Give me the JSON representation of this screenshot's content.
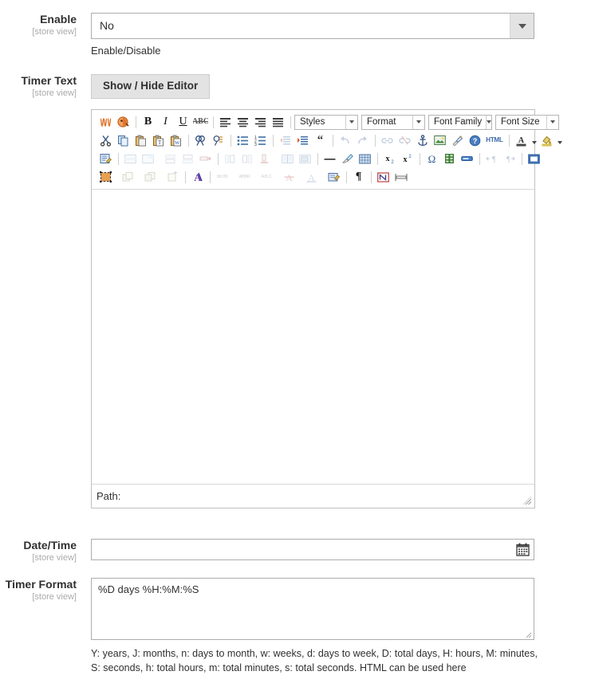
{
  "form": {
    "fields": [
      {
        "label": "Enable",
        "scope": "[store view]",
        "type": "select",
        "value": "No",
        "note": "Enable/Disable"
      },
      {
        "label": "Timer Text",
        "scope": "[store view]",
        "type": "wysiwyg",
        "toggle_button": "Show / Hide Editor",
        "content": ""
      },
      {
        "label": "Date/Time",
        "scope": "[store view]",
        "type": "date",
        "value": ""
      },
      {
        "label": "Timer Format",
        "scope": "[store view]",
        "type": "textarea",
        "value": "%D days %H:%M:%S",
        "note": "Y: years, J: months, n: days to month, w: weeks, d: days to week, D: total days, H: hours, M: minutes, S: seconds, h: total hours, m: total minutes, s: total seconds. HTML can be used here"
      }
    ]
  },
  "editor": {
    "status_label": "Path:",
    "selects": [
      {
        "name": "styles",
        "label": "Styles"
      },
      {
        "name": "format",
        "label": "Format"
      },
      {
        "name": "fontfamily",
        "label": "Font Family"
      },
      {
        "name": "fontsize",
        "label": "Font Size"
      }
    ],
    "row1_icons": [
      "insert-variable-icon",
      "insert-widget-icon",
      "bold-icon",
      "italic-icon",
      "underline-icon",
      "strikethrough-icon",
      "align-left-icon",
      "align-center-icon",
      "align-right-icon",
      "align-justify-icon"
    ],
    "row2_icons": [
      "cut-icon",
      "copy-icon",
      "paste-icon",
      "paste-text-icon",
      "paste-word-icon",
      "search-icon",
      "replace-icon",
      "bullet-list-icon",
      "numbered-list-icon",
      "outdent-icon",
      "indent-icon",
      "blockquote-icon",
      "undo-icon",
      "redo-icon",
      "link-icon",
      "unlink-icon",
      "anchor-icon",
      "image-icon",
      "cleanup-icon",
      "help-icon",
      "html-source-icon",
      "text-color-icon",
      "background-color-icon"
    ],
    "row3_icons": [
      "style-props-icon",
      "table-row-props-icon",
      "table-cell-props-icon",
      "insert-row-before-icon",
      "insert-row-after-icon",
      "delete-row-icon",
      "insert-col-before-icon",
      "insert-col-after-icon",
      "delete-col-icon",
      "split-cells-icon",
      "merge-cells-icon",
      "horizontal-rule-icon",
      "remove-format-icon",
      "toggle-guidelines-icon",
      "subscript-icon",
      "superscript-icon",
      "charmap-icon",
      "emotions-icon",
      "media-icon",
      "direction-ltr-icon",
      "direction-rtl-icon",
      "fullscreen-icon"
    ],
    "row4_icons": [
      "visual-aid-icon",
      "insert-layer-icon",
      "move-forward-icon",
      "move-backward-icon",
      "absolute-position-icon",
      "citation-icon",
      "abbreviation-icon",
      "acronym-icon",
      "deletion-icon",
      "insertion-icon",
      "attributes-icon",
      "visual-chars-icon",
      "nonbreaking-icon",
      "pagebreak-icon"
    ],
    "colors": {
      "accent_orange": "#e08030",
      "toolbar_bg": "#ffffff",
      "border": "#c0c0c0"
    }
  }
}
